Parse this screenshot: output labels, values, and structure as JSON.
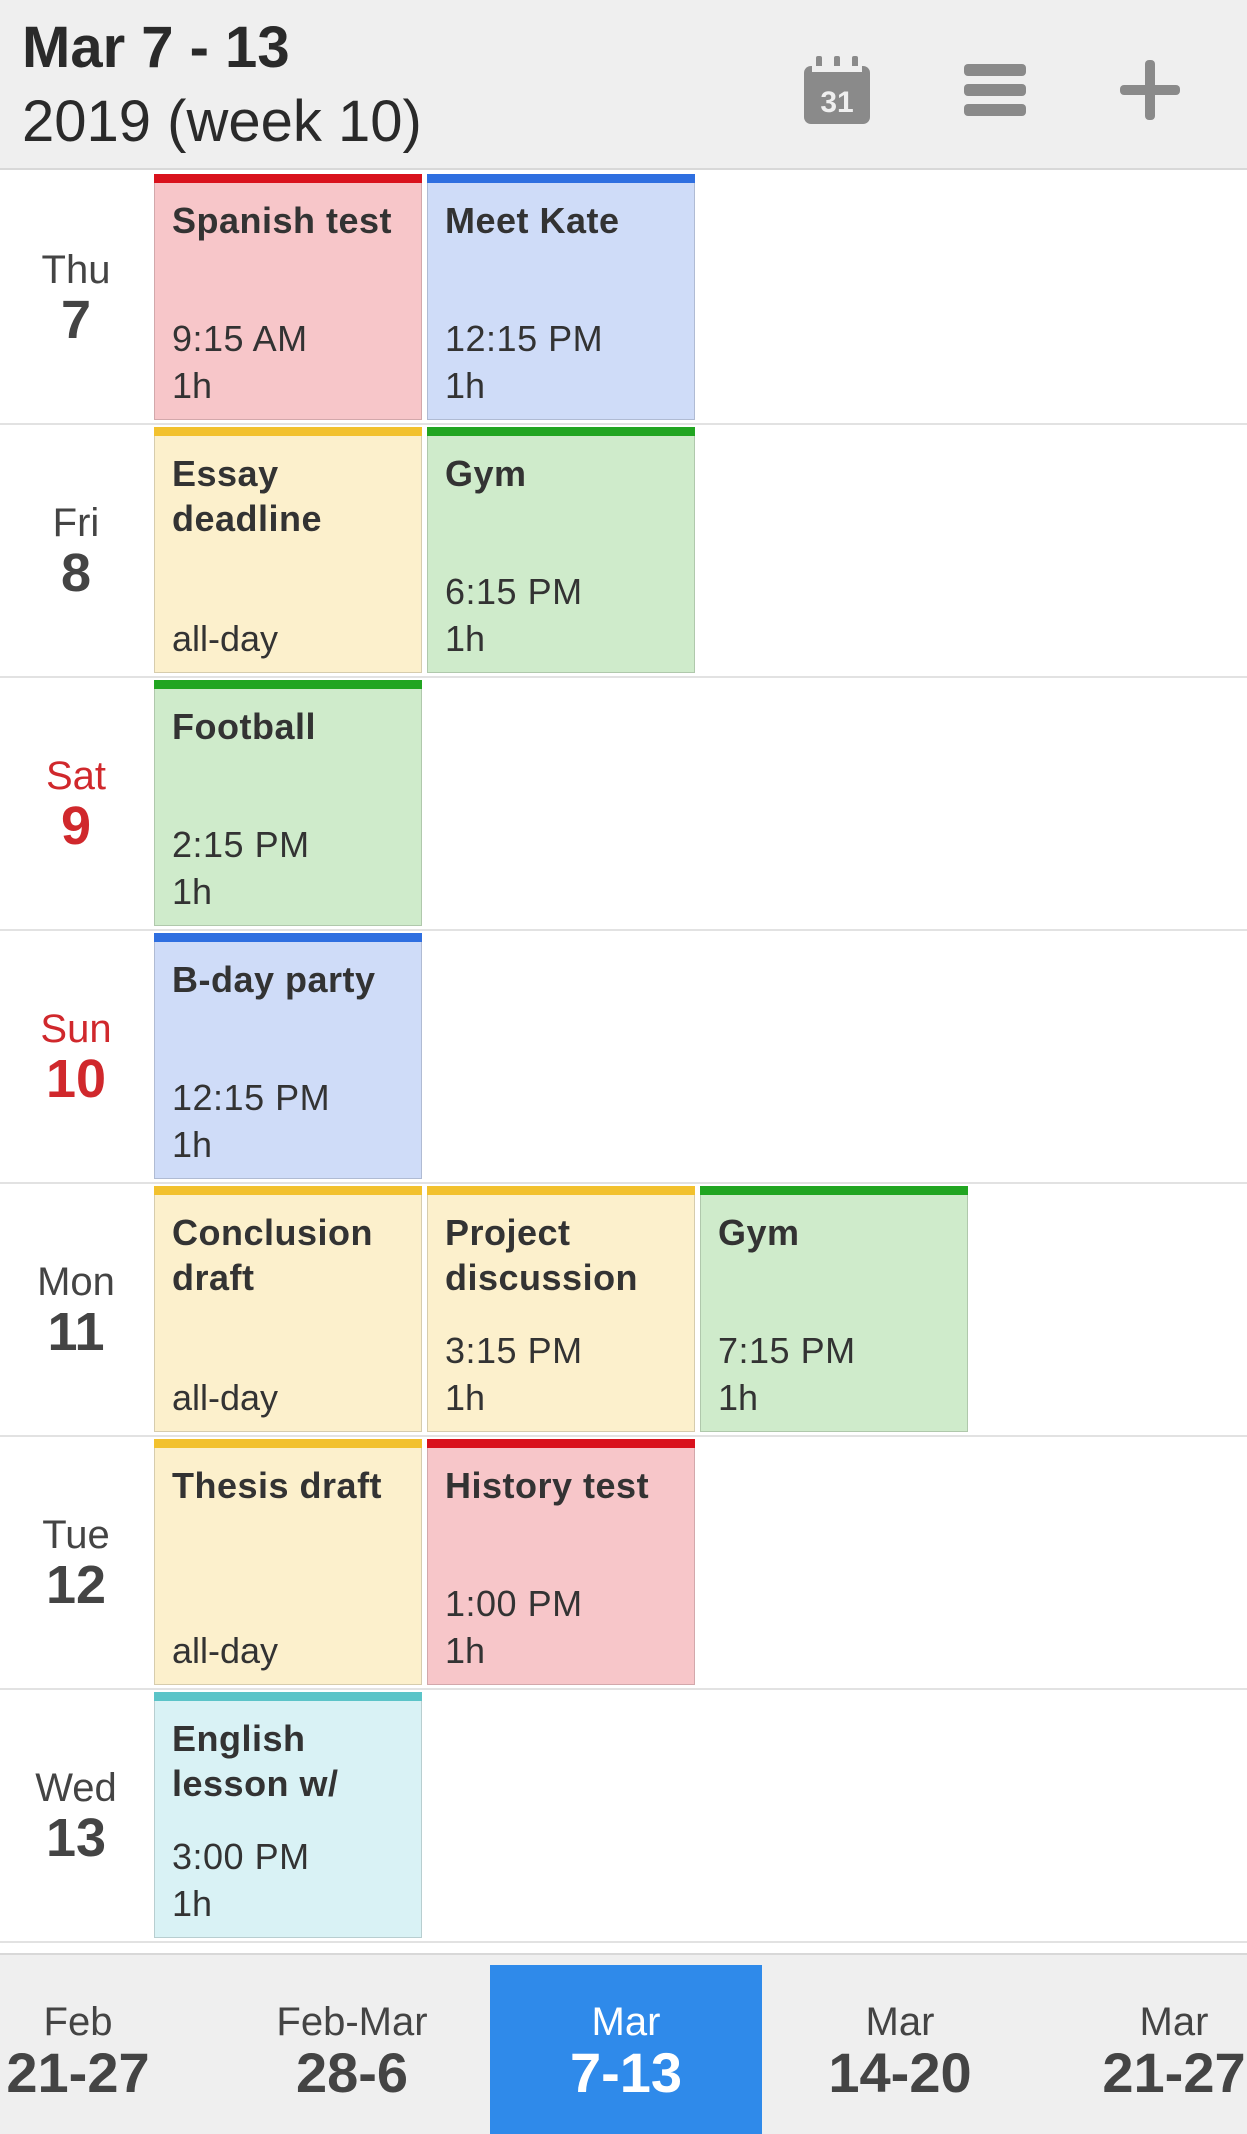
{
  "header": {
    "title": "Mar 7 - 13",
    "subtitle": "2019 (week 10)",
    "calendar_icon_label": "31",
    "icons": [
      "calendar-icon",
      "menu-icon",
      "plus-icon"
    ]
  },
  "days": [
    {
      "name": "Thu",
      "num": "7",
      "weekend": false,
      "events": [
        {
          "title": "Spanish test",
          "time": "9:15 AM",
          "duration": "1h",
          "color": "red"
        },
        {
          "title": "Meet Kate",
          "time": "12:15 PM",
          "duration": "1h",
          "color": "blue"
        }
      ]
    },
    {
      "name": "Fri",
      "num": "8",
      "weekend": false,
      "events": [
        {
          "title": "Essay deadline",
          "time": "",
          "duration": "all-day",
          "color": "yellow"
        },
        {
          "title": "Gym",
          "time": "6:15 PM",
          "duration": "1h",
          "color": "green"
        }
      ]
    },
    {
      "name": "Sat",
      "num": "9",
      "weekend": true,
      "events": [
        {
          "title": "Football",
          "time": "2:15 PM",
          "duration": "1h",
          "color": "green"
        }
      ]
    },
    {
      "name": "Sun",
      "num": "10",
      "weekend": true,
      "events": [
        {
          "title": "B-day party",
          "time": "12:15 PM",
          "duration": "1h",
          "color": "blue"
        }
      ]
    },
    {
      "name": "Mon",
      "num": "11",
      "weekend": false,
      "events": [
        {
          "title": "Conclusion draft",
          "time": "",
          "duration": "all-day",
          "color": "yellow"
        },
        {
          "title": "Project discussion",
          "time": "3:15 PM",
          "duration": "1h",
          "color": "yellow"
        },
        {
          "title": "Gym",
          "time": "7:15 PM",
          "duration": "1h",
          "color": "green"
        }
      ]
    },
    {
      "name": "Tue",
      "num": "12",
      "weekend": false,
      "events": [
        {
          "title": "Thesis draft",
          "time": "",
          "duration": "all-day",
          "color": "yellow"
        },
        {
          "title": "History test",
          "time": "1:00 PM",
          "duration": "1h",
          "color": "red"
        }
      ]
    },
    {
      "name": "Wed",
      "num": "13",
      "weekend": false,
      "events": [
        {
          "title": "English lesson w/",
          "time": "3:00 PM",
          "duration": "1h",
          "color": "teal"
        }
      ]
    }
  ],
  "weeks": [
    {
      "month": "Feb",
      "range": "21-27",
      "selected": false
    },
    {
      "month": "Feb-Mar",
      "range": "28-6",
      "selected": false
    },
    {
      "month": "Mar",
      "range": "7-13",
      "selected": true
    },
    {
      "month": "Mar",
      "range": "14-20",
      "selected": false
    },
    {
      "month": "Mar",
      "range": "21-27",
      "selected": false
    }
  ],
  "colors": {
    "accent": "#2f8aea",
    "weekend": "#d0282c",
    "red": "#d9121d",
    "blue": "#2f6fe0",
    "yellow": "#f2c12e",
    "green": "#21a521",
    "teal": "#5bc4c8"
  }
}
